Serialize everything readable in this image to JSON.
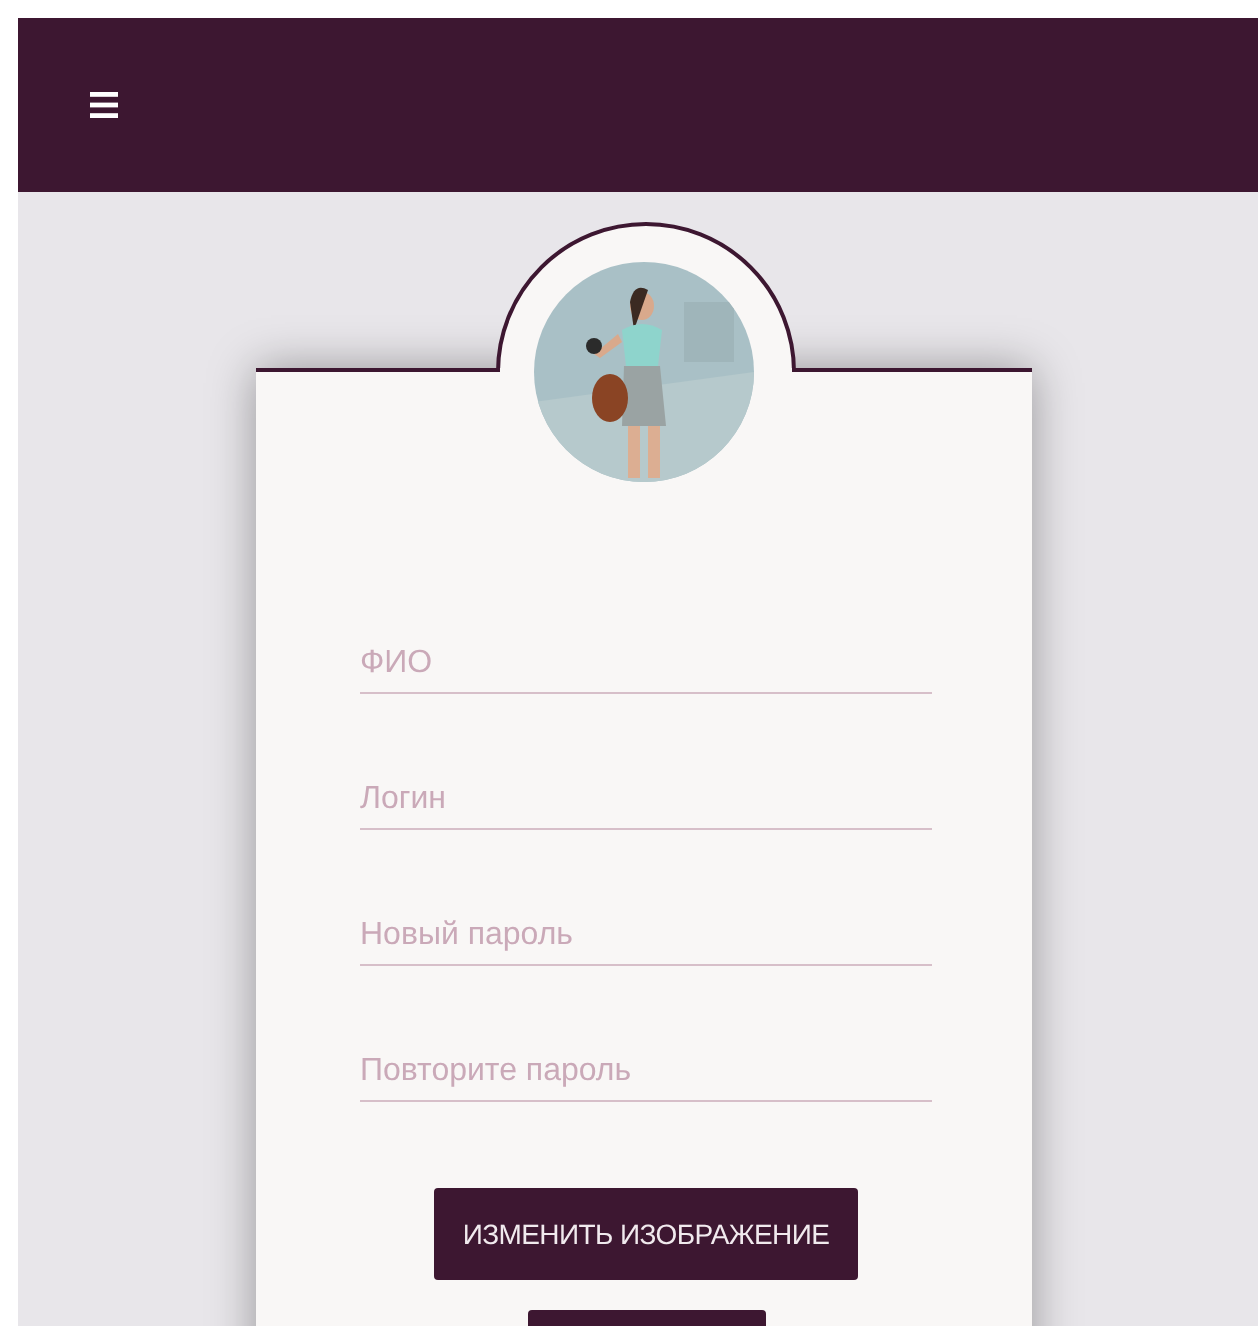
{
  "header": {
    "menu_button": true
  },
  "fields": [
    {
      "placeholder": "ФИО"
    },
    {
      "placeholder": "Логин"
    },
    {
      "placeholder": "Новый пароль"
    },
    {
      "placeholder": "Повторите пароль"
    }
  ],
  "buttons": [
    {
      "label": "ИЗМЕНИТЬ ИЗОБРАЖЕНИЕ"
    }
  ]
}
